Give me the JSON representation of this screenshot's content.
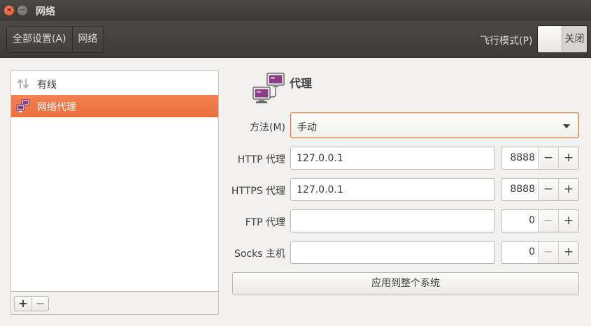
{
  "window": {
    "title": "网络",
    "close_glyph": "×",
    "minimize_glyph": "−"
  },
  "header": {
    "breadcrumbs": [
      "全部设置(A)",
      "网络"
    ],
    "airplane_label": "飞行模式(P)",
    "airplane_state": "关闭"
  },
  "sidebar": {
    "items": [
      {
        "label": "有线",
        "icon": "wired-network-icon",
        "selected": false
      },
      {
        "label": "网络代理",
        "icon": "network-proxy-icon",
        "selected": true
      }
    ],
    "add_label": "+",
    "remove_label": "−"
  },
  "proxy": {
    "title": "代理",
    "method_label": "方法(M)",
    "method_value": "手动",
    "rows": [
      {
        "label": "HTTP 代理",
        "host": "127.0.0.1",
        "port": "8888"
      },
      {
        "label": "HTTPS 代理",
        "host": "127.0.0.1",
        "port": "8888"
      },
      {
        "label": "FTP 代理",
        "host": "",
        "port": "0"
      },
      {
        "label": "Socks 主机",
        "host": "",
        "port": "0"
      }
    ],
    "minus_glyph": "−",
    "plus_glyph": "+",
    "apply_label": "应用到整个系统"
  },
  "colors": {
    "accent": "#f07746",
    "titlebar": "#3c3b37",
    "background": "#f2f1f0"
  }
}
